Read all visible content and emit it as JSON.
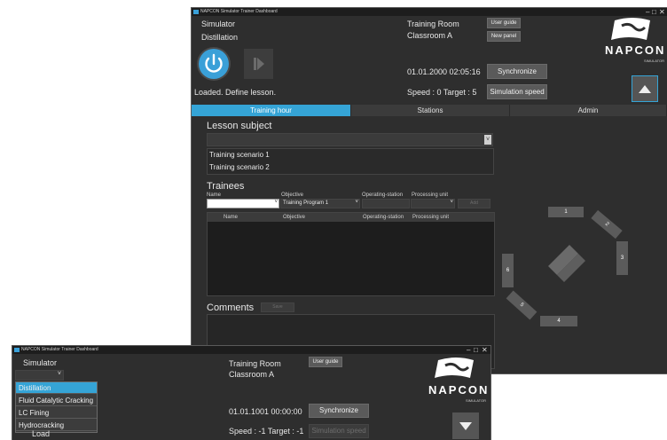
{
  "main_window": {
    "title": "NAPCON Simulator Trainer Dashboard",
    "controls": {
      "minimize": "–",
      "maximize": "□",
      "close": "✕"
    },
    "simulator_label": "Simulator",
    "simulator_value": "Distillation",
    "status_text": "Loaded. Define lesson.",
    "training_room": "Training Room",
    "classroom": "Classroom A",
    "user_guide": "User guide",
    "new_panel": "New panel",
    "datetime": "01.01.2000 02:05:16",
    "synchronize": "Synchronize",
    "speed": "Speed : 0 Target : 5",
    "simulation_speed": "Simulation speed",
    "logo": {
      "brand": "NAPCON",
      "sub": "SIMULATOR"
    },
    "tabs": [
      "Training hour",
      "Stations",
      "Admin"
    ],
    "lesson_subject": "Lesson subject",
    "scenarios": [
      "Training scenario 1",
      "Training scenario 2"
    ],
    "trainees": "Trainees",
    "trainee_form": {
      "name_label": "Name",
      "objective_label": "Objective",
      "objective_value": "Training Program 1",
      "station_label": "Operating-station",
      "unit_label": "Processing unit",
      "add_button": "Add"
    },
    "table_headers": [
      "Name",
      "Objective",
      "Operating-station",
      "Processing unit"
    ],
    "comments": "Comments",
    "save_button": "Save",
    "stations": [
      "1",
      "2",
      "3",
      "4",
      "5",
      "6"
    ]
  },
  "second_window": {
    "title": "NAPCON Simulator Trainer Dashboard",
    "simulator_label": "Simulator",
    "dropdown_options": [
      "Distillation",
      "Fluid Catalytic Cracking",
      "LC Fining",
      "Hydrocracking"
    ],
    "load_label": "Load",
    "training_room": "Training Room",
    "classroom": "Classroom A",
    "user_guide": "User guide",
    "datetime": "01.01.1001 00:00:00",
    "synchronize": "Synchronize",
    "speed": "Speed : -1 Target : -1",
    "simulation_speed": "Simulation speed",
    "logo": {
      "brand": "NAPCON",
      "sub": "SIMULATOR"
    }
  },
  "colors": {
    "accent": "#35a4d6",
    "background": "#2e2e2e",
    "panel": "#3b3b3b"
  }
}
